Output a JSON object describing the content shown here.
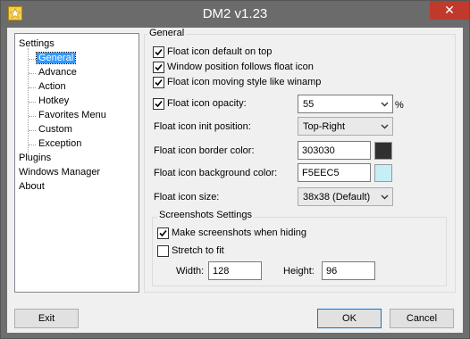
{
  "window": {
    "title": "DM2 v1.23",
    "close_glyph": "✕"
  },
  "tree": {
    "items": [
      {
        "label": "Settings",
        "level": 0
      },
      {
        "label": "General",
        "level": 1,
        "selected": true
      },
      {
        "label": "Advance",
        "level": 1
      },
      {
        "label": "Action",
        "level": 1
      },
      {
        "label": "Hotkey",
        "level": 1
      },
      {
        "label": "Favorites Menu",
        "level": 1
      },
      {
        "label": "Custom",
        "level": 1
      },
      {
        "label": "Exception",
        "level": 1
      },
      {
        "label": "Plugins",
        "level": 0
      },
      {
        "label": "Windows Manager",
        "level": 0
      },
      {
        "label": "About",
        "level": 0
      }
    ]
  },
  "general": {
    "group_title": "General",
    "float_on_top": {
      "label": "Float icon default on top",
      "checked": true
    },
    "follow_float": {
      "label": "Window position follows float icon",
      "checked": true
    },
    "winamp_style": {
      "label": "Float icon moving style like winamp",
      "checked": true
    },
    "opacity": {
      "label": "Float icon opacity:",
      "checked": true,
      "value": "55",
      "unit": "%"
    },
    "init_position": {
      "label": "Float icon init position:",
      "value": "Top-Right"
    },
    "border_color": {
      "label": "Float icon border color:",
      "value": "303030",
      "swatch": "#303030"
    },
    "background_color": {
      "label": "Float icon background color:",
      "value": "F5EEC5",
      "swatch": "#c5eef5"
    },
    "icon_size": {
      "label": "Float icon size:",
      "value": "38x38 (Default)"
    }
  },
  "screenshots": {
    "group_title": "Screenshots Settings",
    "make_when_hiding": {
      "label": "Make screenshots when hiding",
      "checked": true
    },
    "stretch": {
      "label": "Stretch to fit",
      "checked": false
    },
    "width": {
      "label": "Width:",
      "value": "128"
    },
    "height": {
      "label": "Height:",
      "value": "96"
    }
  },
  "buttons": {
    "exit": "Exit",
    "ok": "OK",
    "cancel": "Cancel"
  },
  "icons": {
    "app": "star-icon",
    "close": "close-icon",
    "dropdown": "chevron-down-icon",
    "check": "checkmark-icon"
  }
}
